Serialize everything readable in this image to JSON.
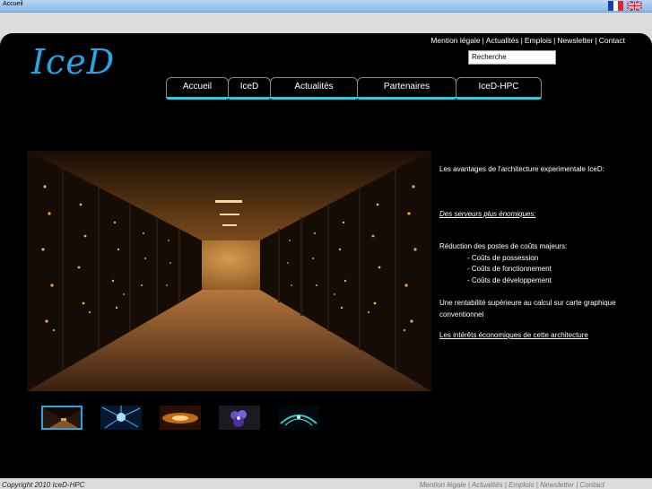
{
  "window": {
    "title": "Accueil"
  },
  "languages": [
    {
      "name": "fr-flag-icon",
      "colors": [
        "#1f3fa8",
        "#ffffff",
        "#e0262b"
      ]
    },
    {
      "name": "uk-flag-icon",
      "colors": [
        "#1f3fa8",
        "#ffffff",
        "#e0262b"
      ]
    }
  ],
  "brand": {
    "logo_text": "IceD",
    "accent": "#27a6e6",
    "nav_accent": "#1fd1ea"
  },
  "top_links": [
    "Mention légale",
    "Actualités",
    "Emplois",
    "Newsletter",
    "Contact"
  ],
  "search": {
    "placeholder": "Recherche"
  },
  "nav": [
    "Accueil",
    "IceD",
    "Actualités",
    "Partenaires",
    "IceD-HPC"
  ],
  "hero": {
    "icon": "server-room-photo"
  },
  "description": {
    "intro": "Les avantages de l'architecture experimentale IceD:",
    "link_servers": "Des serveurs plus énomiques:",
    "reduction_title": "Réduction des postes de coûts majeurs:",
    "costs": [
      "- Coûts de possession",
      "- Coûts de fonctionnement",
      "- Coûts de développement"
    ],
    "profitability": "Une rentabilité supérieure au calcul sur carte graphique conventionnel",
    "link_economics": "Les intérêts économiques de cette architecture"
  },
  "thumbnails": [
    {
      "name": "server-room",
      "selected": true
    },
    {
      "name": "blue-burst",
      "selected": false
    },
    {
      "name": "orange-light",
      "selected": false
    },
    {
      "name": "purple-flower",
      "selected": false
    },
    {
      "name": "teal-fractal",
      "selected": false
    }
  ],
  "footer": {
    "copyright": "Copyright 2010 IceD-HPC",
    "links": [
      "Mention légale",
      "Actualités",
      "Emplois",
      "Newsletter",
      "Contact"
    ]
  }
}
